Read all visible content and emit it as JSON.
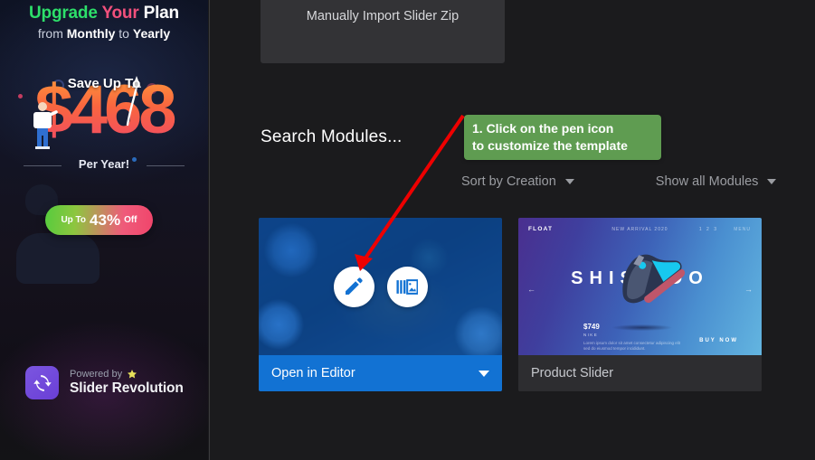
{
  "sidebar": {
    "headline": {
      "word1": "Upgrade",
      "word2": "Your",
      "word3": "Plan"
    },
    "subheadline_prefix": "from ",
    "subheadline_bold1": "Monthly",
    "subheadline_mid": " to ",
    "subheadline_bold2": "Yearly",
    "promo": {
      "save_label": "Save Up To",
      "amount": "$468",
      "period": "Per Year!",
      "badge_prefix": "Up To",
      "badge_amount": "43%",
      "badge_suffix": "Off"
    },
    "powered": {
      "prefix": "Powered by",
      "star_icon": "star-icon",
      "product": "Slider Revolution",
      "logo_icon": "slider-revolution-refresh-logo"
    },
    "colors": {
      "accent_green": "#2ddf6a",
      "accent_pink": "#f2507c",
      "logo_purple": "#6a3fd6"
    }
  },
  "main": {
    "import_box_label": "Manually Import Slider Zip",
    "search_placeholder": "Search Modules...",
    "filters": [
      {
        "label": "Sort by Creation",
        "icon": "chevron-down-icon"
      },
      {
        "label": "Show all Modules",
        "icon": "chevron-down-icon"
      }
    ],
    "cards": [
      {
        "id": "card-open-in-editor",
        "bar_label": "Open in Editor",
        "bar_style": "blue",
        "bar_icon": "chevron-down-icon",
        "overlay_visible": true,
        "actions": [
          {
            "name": "edit-pen-button",
            "icon": "pen-icon"
          },
          {
            "name": "preview-slides-button",
            "icon": "slideshow-icon"
          }
        ]
      },
      {
        "id": "card-product-slider",
        "bar_label": "Product Slider",
        "bar_style": "dark",
        "overlay_visible": false,
        "preview": {
          "brand": "FLOAT",
          "top_center": "NEW ARRIVAL 2020",
          "top_right": "1  2  3",
          "top_right2": "MENU",
          "word": "SHISHIDO",
          "price": "$749",
          "brand_small": "NIKE",
          "description": "Lorem ipsum dolor sit amet consectetur adipiscing elit sed do eiusmod tempor incididunt.",
          "buy_label": "BUY NOW",
          "arrow_left": "←",
          "arrow_right": "→"
        }
      }
    ]
  },
  "annotation": {
    "step_line1": "1. Click on the pen icon",
    "step_line2": "to customize the template",
    "box_color": "#5f9c51",
    "arrow_color": "#ee0000"
  }
}
